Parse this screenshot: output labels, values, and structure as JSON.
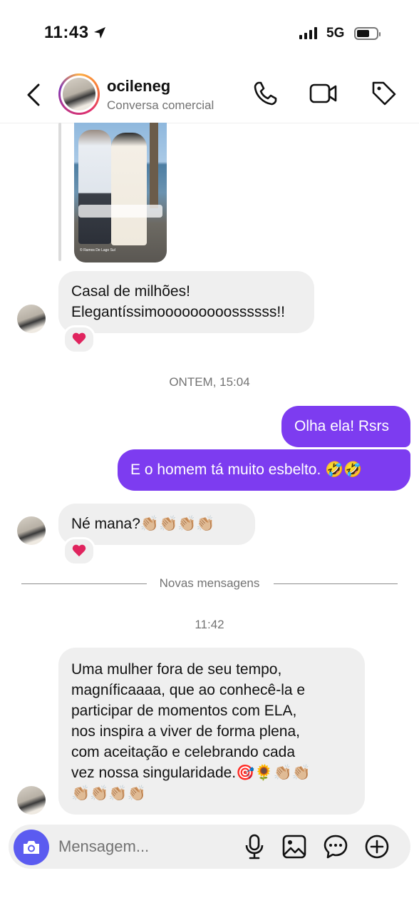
{
  "status_bar": {
    "time": "11:43",
    "network": "5G"
  },
  "header": {
    "username": "ocileneg",
    "subtitle": "Conversa comercial",
    "icons": [
      "back-icon",
      "phone-icon",
      "video-icon",
      "tag-icon"
    ]
  },
  "shared_image": {
    "credit": "© Ramos De Lago Sul"
  },
  "messages": {
    "m1": {
      "line1": "Casal de milhões!",
      "line2": "Elegantíssimooooooooossssss!!",
      "reaction": "❤️"
    },
    "ts1": "ONTEM, 15:04",
    "m2": "Olha ela! Rsrs",
    "m3": "E o homem tá muito esbelto. 🤣🤣",
    "m4": {
      "text": "Né mana?👏🏼👏🏼👏🏼👏🏼",
      "reaction": "❤️"
    },
    "divider": "Novas mensagens",
    "ts2": "11:42",
    "m5": {
      "l1": "Uma mulher fora de seu tempo,",
      "l2": "magníficaaaa, que ao conhecê-la e",
      "l3": "participar de momentos com ELA,",
      "l4": "nos inspira a viver de forma plena,",
      "l5": "com aceitação e celebrando cada",
      "l6": "vez nossa singularidade.🎯🌻👏🏼👏🏼",
      "l7": "👏🏼👏🏼👏🏼👏🏼"
    }
  },
  "composer": {
    "placeholder": "Mensagem...",
    "icons": [
      "camera-icon",
      "microphone-icon",
      "gallery-icon",
      "sticker-icon",
      "plus-icon"
    ]
  },
  "colors": {
    "outgoing_bubble": "#7d3cf0",
    "incoming_bubble": "#efefef",
    "camera_button": "#5b5bf0"
  }
}
